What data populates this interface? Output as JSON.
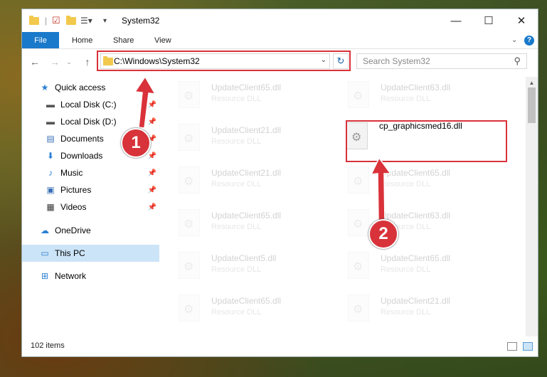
{
  "window": {
    "title": "System32"
  },
  "ribbon": {
    "tabs": [
      "File",
      "Home",
      "Share",
      "View"
    ]
  },
  "address": {
    "path": "C:\\Windows\\System32"
  },
  "search": {
    "placeholder": "Search System32"
  },
  "sidebar": {
    "items": [
      {
        "label": "Quick access",
        "icon": "star-icon"
      },
      {
        "label": "Local Disk (C:)",
        "icon": "drive-icon"
      },
      {
        "label": "Local Disk (D:)",
        "icon": "drive-icon"
      },
      {
        "label": "Documents",
        "icon": "documents-icon"
      },
      {
        "label": "Downloads",
        "icon": "download-icon"
      },
      {
        "label": "Music",
        "icon": "music-icon"
      },
      {
        "label": "Pictures",
        "icon": "pictures-icon"
      },
      {
        "label": "Videos",
        "icon": "videos-icon"
      },
      {
        "label": "OneDrive",
        "icon": "cloud-icon"
      },
      {
        "label": "This PC",
        "icon": "computer-icon"
      },
      {
        "label": "Network",
        "icon": "network-icon"
      }
    ]
  },
  "files": {
    "left": [
      {
        "name": "UpdateClient65.dll",
        "type": "Resource DLL"
      },
      {
        "name": "UpdateClient21.dll",
        "type": "Resource DLL"
      },
      {
        "name": "UpdateClient21.dll",
        "type": "Resource DLL"
      },
      {
        "name": "UpdateClient65.dll",
        "type": "Resource DLL"
      },
      {
        "name": "UpdateClient5.dll",
        "type": "Resource DLL"
      },
      {
        "name": "UpdateClient65.dll",
        "type": "Resource DLL"
      }
    ],
    "right": [
      {
        "name": "UpdateClient63.dll",
        "type": "Resource DLL"
      },
      {
        "name": "cp_graphicsmed16.dll",
        "type": ""
      },
      {
        "name": "UpdateClient65.dll",
        "type": "Resource DLL"
      },
      {
        "name": "UpdateClient63.dll",
        "type": "Resource DLL"
      },
      {
        "name": "UpdateClient65.dll",
        "type": "Resource DLL"
      },
      {
        "name": "UpdateClient21.dll",
        "type": "Resource DLL"
      }
    ]
  },
  "status": {
    "count": "102 items"
  },
  "annotations": {
    "badge1": "1",
    "badge2": "2"
  },
  "colors": {
    "accent": "#1979ca",
    "highlight": "#d9323a"
  }
}
